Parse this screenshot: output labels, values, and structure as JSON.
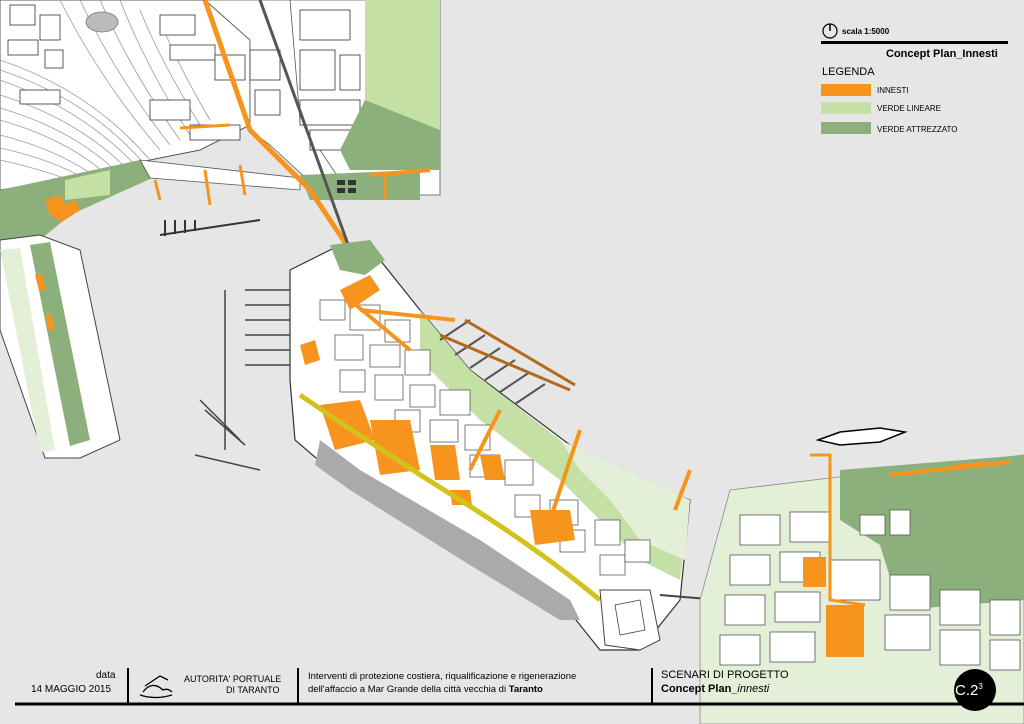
{
  "scale": {
    "label": "scala 1:5000"
  },
  "plan_title": "Concept Plan_Innesti",
  "legend": {
    "title": "LEGENDA",
    "items": [
      {
        "label": "INNESTI",
        "color": "#f7941d"
      },
      {
        "label": "VERDE LINEARE",
        "color": "#c5e0a5"
      },
      {
        "label": "VERDE ATTREZZATO",
        "color": "#8cb07c"
      }
    ]
  },
  "colors": {
    "background": "#e6e6e6",
    "land": "#ffffff",
    "innesti": "#f7941d",
    "verde_lineare": "#c5e0a5",
    "verde_attrezzato": "#8cb07c",
    "light_green": "#e4efd8",
    "promenade": "#d4c21c",
    "dark_gray": "#777777"
  },
  "footer": {
    "date_label": "data",
    "date_value": "14 MAGGIO 2015",
    "authority_line1": "AUTORITA' PORTUALE",
    "authority_line2": "DI TARANTO",
    "project_line1": "Interventi di protezione costiera, riqualificazione e rigenerazione",
    "project_line2_prefix": "dell'affaccio a Mar Grande della città vecchia di",
    "project_line2_city": "Taranto",
    "section_title": "SCENARI DI PROGETTO",
    "section_sub_prefix": "Concept Plan_",
    "section_sub_italic": "innesti",
    "sheet_code": "C.2",
    "sheet_sup": "3"
  },
  "icons": [
    "north-arrow-icon",
    "authority-logo-icon"
  ]
}
